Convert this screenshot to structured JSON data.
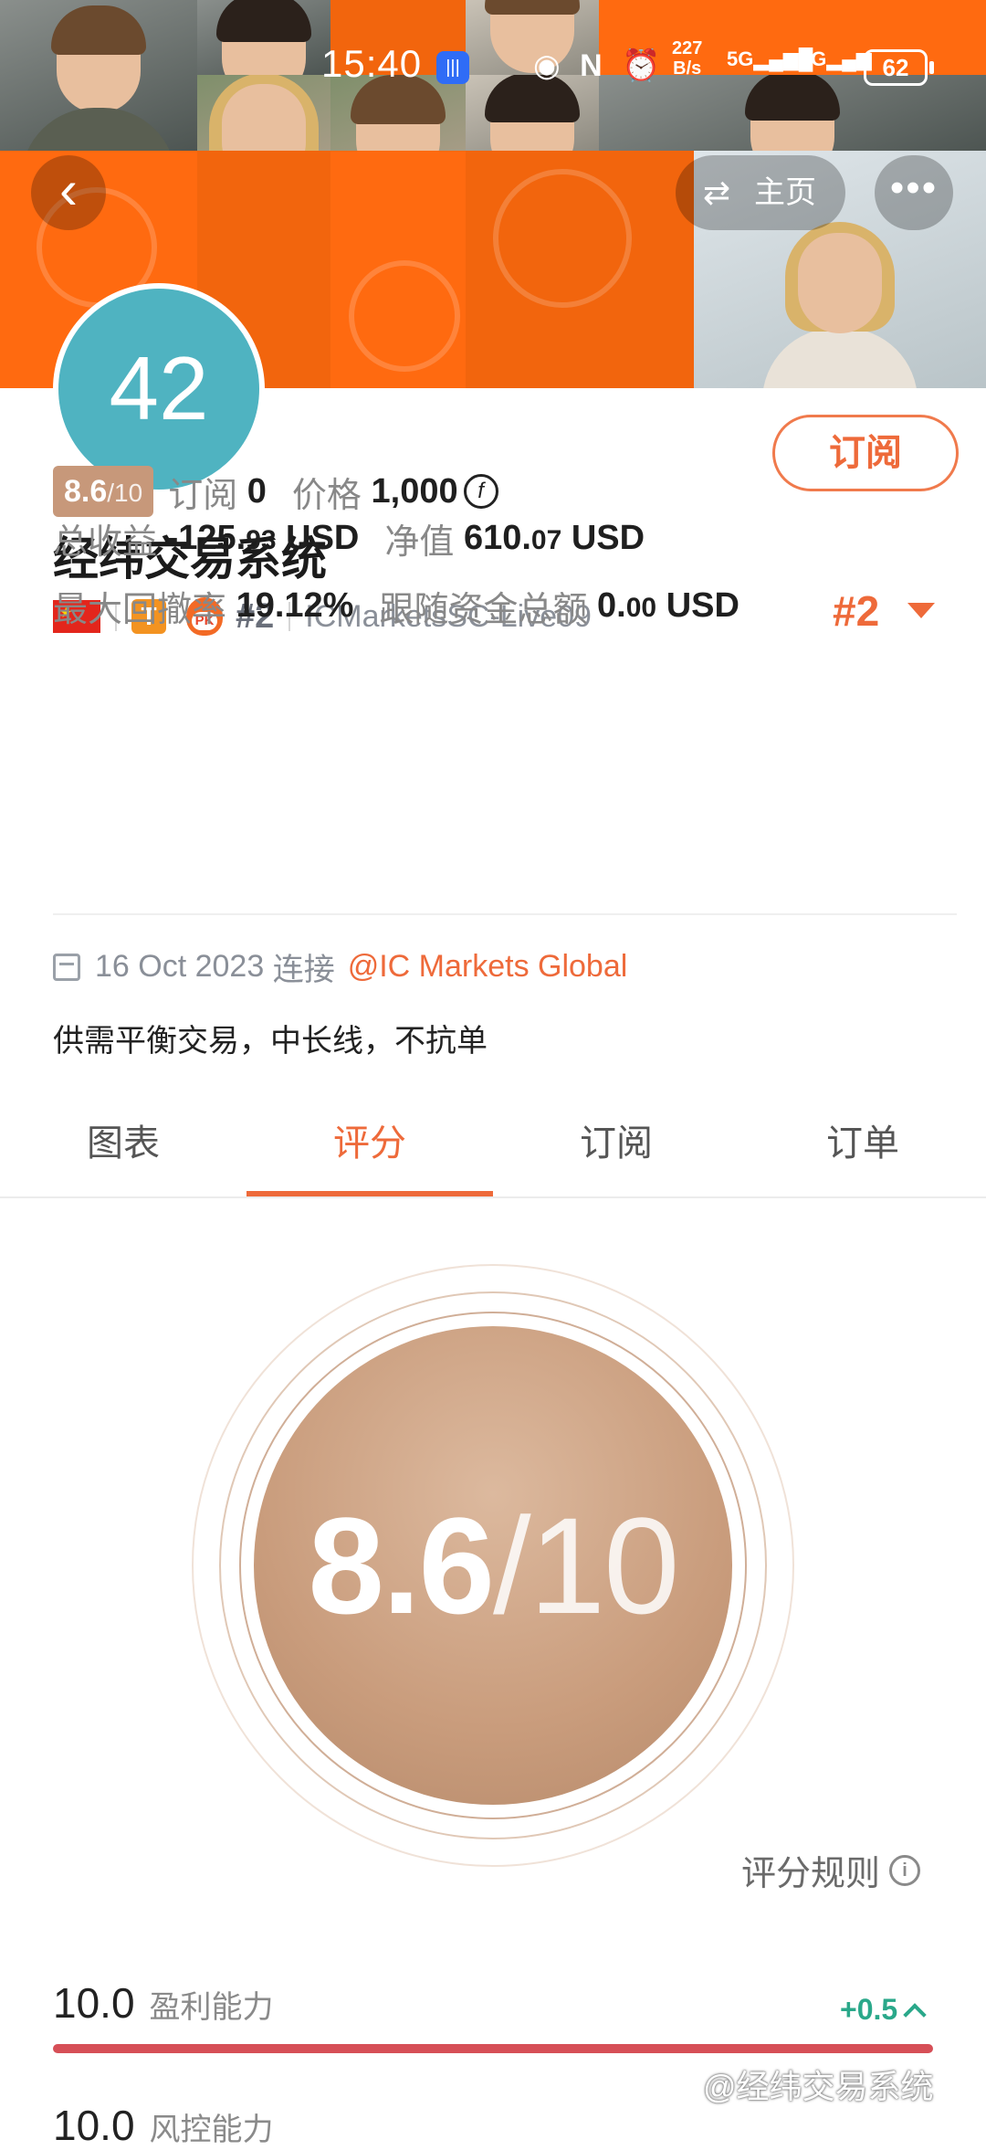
{
  "status_bar": {
    "time": "15:40",
    "speed_value": "227",
    "speed_unit": "B/s",
    "net_5g": "5G",
    "net_3g": "3G",
    "battery": "62"
  },
  "header": {
    "home_label": "主页",
    "avatar_text": "42",
    "subscribe_label": "订阅"
  },
  "profile": {
    "name": "经纬交易系统",
    "t_badge": "T",
    "pk_label": "PK",
    "rank_small": "#2",
    "broker": "ICMarketsSC-Live09",
    "rank_big": "#2"
  },
  "stats": {
    "score_main": "8.6",
    "score_den": "/10",
    "subscribe_label": "订阅",
    "subscribe_count": "0",
    "price_label": "价格",
    "price_value": "1,000",
    "price_coin": "f",
    "total_profit_label": "总收益",
    "total_profit_int": "-125.",
    "total_profit_dec": "93",
    "total_profit_unit": "USD",
    "net_value_label": "净值",
    "net_value_int": "610.",
    "net_value_dec": "07",
    "net_value_unit": "USD",
    "max_drawdown_label": "最大回撤率",
    "max_drawdown_value": "19.12%",
    "follow_funds_label": "跟随资金总额",
    "follow_funds_int": "0.",
    "follow_funds_dec": "00",
    "follow_funds_unit": "USD"
  },
  "connect": {
    "date": "16 Oct 2023",
    "connect_word": "连接",
    "link": "@IC Markets Global"
  },
  "description": "供需平衡交易，中长线，不抗单",
  "tabs": [
    {
      "label": "图表",
      "active": false
    },
    {
      "label": "评分",
      "active": true
    },
    {
      "label": "订阅",
      "active": false
    },
    {
      "label": "订单",
      "active": false
    }
  ],
  "score_circle": {
    "value": "8.6",
    "denominator": "/10"
  },
  "rules_label": "评分规则",
  "info_glyph": "i",
  "metrics": [
    {
      "value": "10.0",
      "label": "盈利能力",
      "delta": "+0.5",
      "fill_fraction": 1.0,
      "bar_color": "#d64f57"
    },
    {
      "value": "10.0",
      "label": "风控能力"
    }
  ],
  "watermark": "@经纬交易系统",
  "colors": {
    "accent": "#ee6a3a",
    "avatar_bg": "#4fb3c1",
    "score_chip": "#c7987a",
    "delta_green": "#2aa88a",
    "banner_orange": "#ff6a10"
  }
}
